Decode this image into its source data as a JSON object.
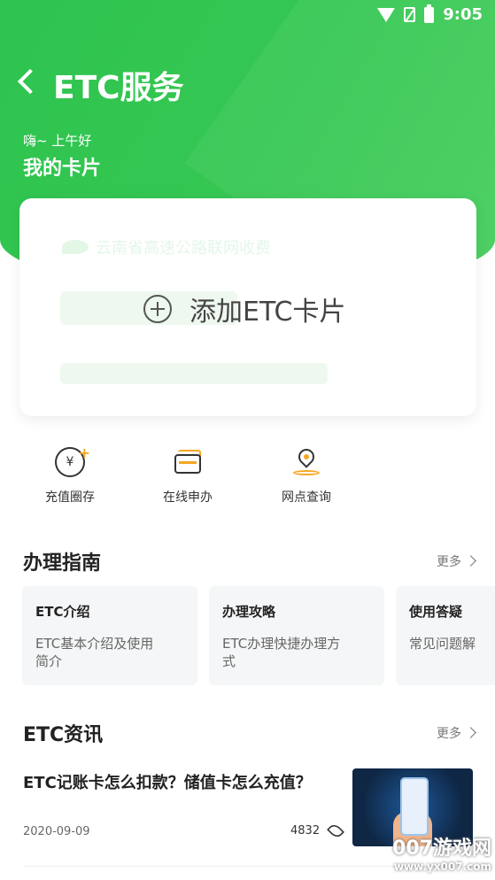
{
  "status_bar": {
    "time": "9:05"
  },
  "header": {
    "title": "ETC服务",
    "greeting": "嗨~ 上午好",
    "section_title": "我的卡片"
  },
  "card": {
    "issuer_text": "云南省高速公路联网收费",
    "add_label": "添加ETC卡片"
  },
  "actions": [
    {
      "label": "充值圈存",
      "icon": "recharge-icon"
    },
    {
      "label": "在线申办",
      "icon": "card-apply-icon"
    },
    {
      "label": "网点查询",
      "icon": "location-pin-icon"
    }
  ],
  "guide_section": {
    "title": "办理指南",
    "more": "更多",
    "items": [
      {
        "title": "ETC介绍",
        "desc_line1": "ETC基本介绍及使用",
        "desc_line2": "简介"
      },
      {
        "title": "办理攻略",
        "desc_line1": "ETC办理快捷办理方",
        "desc_line2": "式"
      },
      {
        "title": "使用答疑",
        "desc_line1": "常见问题解",
        "desc_line2": ""
      }
    ]
  },
  "news_section": {
    "title": "ETC资讯",
    "more": "更多",
    "items": [
      {
        "title": "ETC记账卡怎么扣款？储值卡怎么充值？",
        "date": "2020-09-09",
        "views": "4832"
      }
    ]
  },
  "watermark": {
    "line1": "007游戏网",
    "line2": "www.yx007.com"
  },
  "colors": {
    "brand_green": "#36c753",
    "accent_orange": "#f5a623"
  }
}
